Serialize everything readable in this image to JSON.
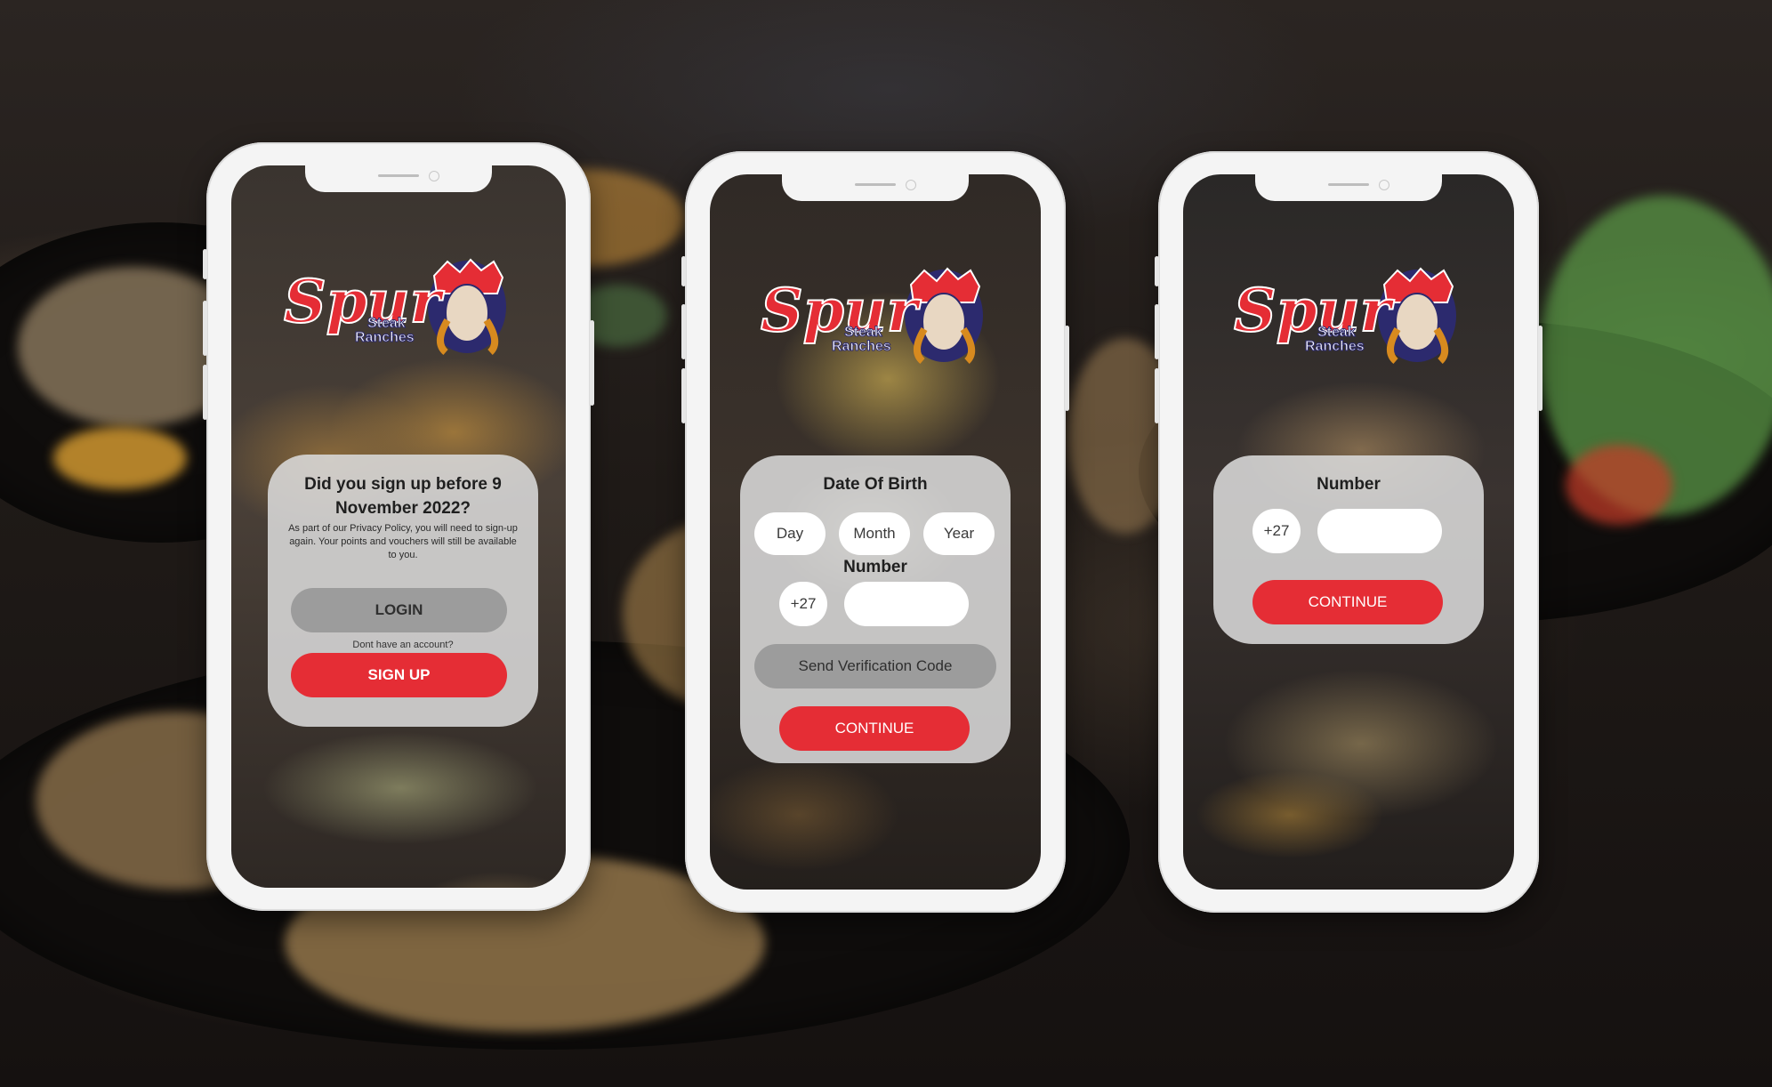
{
  "brand": {
    "name": "Spur",
    "tagline": "Steak Ranches",
    "red": "#e52d35",
    "navy": "#2c2a6e"
  },
  "screens": [
    {
      "title": "Did you sign up before 9 November 2022?",
      "body": "As part of our Privacy Policy, you will need to sign-up again. Your points and vouchers will still be available to you.",
      "login_label": "LOGIN",
      "no_account_text": "Dont have an account?",
      "signup_label": "SIGN UP"
    },
    {
      "dob_title": "Date Of Birth",
      "day_label": "Day",
      "month_label": "Month",
      "year_label": "Year",
      "number_title": "Number",
      "country_code": "+27",
      "number_value": "",
      "send_code_label": "Send Verification Code",
      "continue_label": "CONTINUE"
    },
    {
      "number_title": "Number",
      "country_code": "+27",
      "number_value": "",
      "continue_label": "CONTINUE"
    }
  ]
}
